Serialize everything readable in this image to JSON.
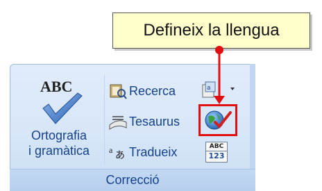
{
  "tooltip": {
    "text": "Defineix la llengua"
  },
  "group": {
    "label": "Correcció",
    "spelling": {
      "icon_text": "ABC",
      "label_line1": "Ortografia",
      "label_line2": "i gramàtica"
    },
    "research": {
      "label": "Recerca",
      "icon": "research-book-icon"
    },
    "thesaurus": {
      "label": "Tesaurus",
      "icon": "thesaurus-book-icon"
    },
    "translate": {
      "label": "Tradueix",
      "icon": "translate-icon"
    },
    "translate_tip": {
      "icon": "translation-screentip-icon"
    },
    "set_language": {
      "icon": "globe-check-icon"
    },
    "word_count": {
      "icon_line1": "ABC",
      "icon_line2": "123"
    }
  },
  "colors": {
    "highlight": "#e01010",
    "label": "#15428b",
    "tooltip_bg": "#ffffcc"
  }
}
